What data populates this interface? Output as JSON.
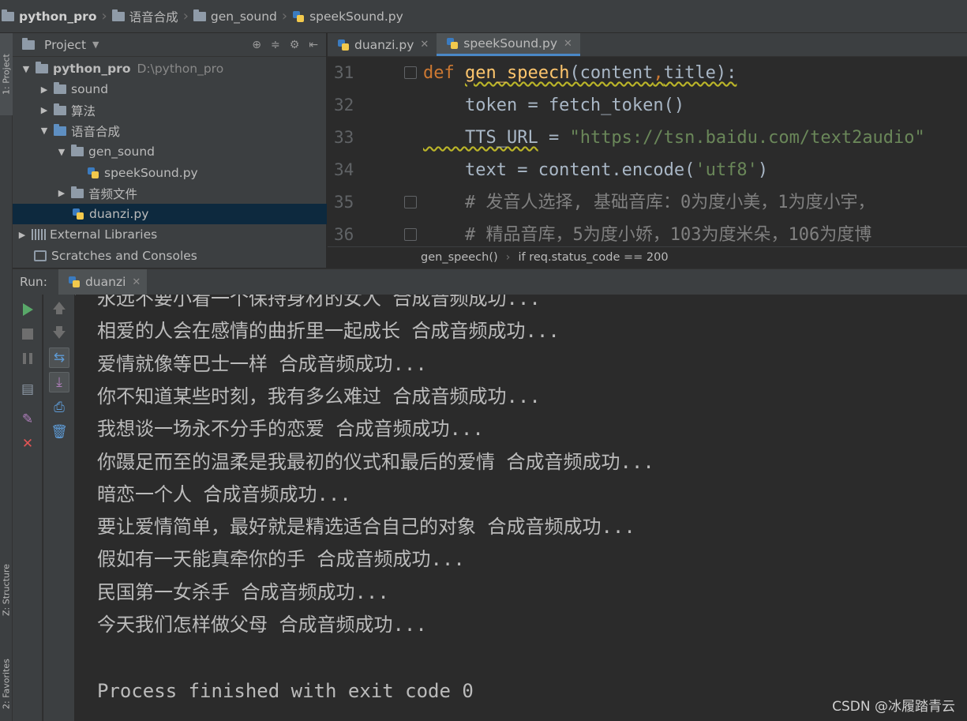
{
  "breadcrumb": [
    {
      "label": "python_pro",
      "icon": "folder-icon",
      "bold": true
    },
    {
      "label": "语音合成",
      "icon": "folder-icon"
    },
    {
      "label": "gen_sound",
      "icon": "folder-icon"
    },
    {
      "label": "speekSound.py",
      "icon": "python-file-icon"
    }
  ],
  "sidebar_tabs": {
    "project": "1: Project",
    "structure": "Z: Structure",
    "favorites": "2: Favorites"
  },
  "project_panel": {
    "title": "Project",
    "tree": [
      {
        "label": "python_pro",
        "hint": "D:\\python_pro",
        "expanded": true
      },
      {
        "label": "sound",
        "expanded": false
      },
      {
        "label": "算法",
        "expanded": false
      },
      {
        "label": "语音合成",
        "expanded": true
      },
      {
        "label": "gen_sound",
        "expanded": true
      },
      {
        "label": "speekSound.py"
      },
      {
        "label": "音频文件",
        "expanded": false
      },
      {
        "label": "duanzi.py",
        "selected": true
      },
      {
        "label": "External Libraries",
        "expanded": false
      },
      {
        "label": "Scratches and Consoles"
      }
    ]
  },
  "editor": {
    "tabs": [
      {
        "label": "duanzi.py",
        "active": false
      },
      {
        "label": "speekSound.py",
        "active": true
      }
    ],
    "lines": [
      {
        "number": "31",
        "parts": [
          {
            "t": "def ",
            "c": "kw"
          },
          {
            "t": "gen_speech",
            "c": "fn"
          },
          {
            "t": "(content",
            "c": "plain"
          },
          {
            "t": ",",
            "c": "kw"
          },
          {
            "t": "title):",
            "c": "plain"
          }
        ]
      },
      {
        "number": "32",
        "parts": [
          {
            "t": "    token = fetch_token()",
            "c": "plain"
          }
        ]
      },
      {
        "number": "33",
        "parts": [
          {
            "t": "    TTS_URL",
            "c": "plain"
          },
          {
            "t": " = ",
            "c": "plain"
          },
          {
            "t": "\"https://tsn.baidu.com/text2audio\"",
            "c": "str"
          }
        ]
      },
      {
        "number": "34",
        "parts": [
          {
            "t": "    text = content.encode(",
            "c": "plain"
          },
          {
            "t": "'utf8'",
            "c": "str"
          },
          {
            "t": ")",
            "c": "plain"
          }
        ]
      },
      {
        "number": "35",
        "parts": [
          {
            "t": "    # 发音人选择, 基础音库：0为度小美，1为度小宇，",
            "c": "cmt"
          }
        ]
      },
      {
        "number": "36",
        "parts": [
          {
            "t": "    # 精品音库，5为度小娇，103为度米朵，106为度博",
            "c": "cmt"
          }
        ]
      }
    ],
    "status_breadcrumb": [
      "gen_speech()",
      "if req.status_code == 200"
    ]
  },
  "run": {
    "label": "Run:",
    "tab": "duanzi",
    "output": [
      "永远不要小看一个保持身材的女人 合成音频成功...",
      "相爱的人会在感情的曲折里一起成长 合成音频成功...",
      "爱情就像等巴士一样 合成音频成功...",
      "你不知道某些时刻，我有多么难过 合成音频成功...",
      "我想谈一场永不分手的恋爱 合成音频成功...",
      "你蹑足而至的温柔是我最初的仪式和最后的爱情 合成音频成功...",
      "暗恋一个人 合成音频成功...",
      "要让爱情简单，最好就是精选适合自己的对象 合成音频成功...",
      "假如有一天能真牵你的手 合成音频成功...",
      "民国第一女杀手 合成音频成功...",
      "今天我们怎样做父母 合成音频成功...",
      "",
      "Process finished with exit code 0"
    ]
  },
  "watermark": "CSDN @冰履踏青云"
}
